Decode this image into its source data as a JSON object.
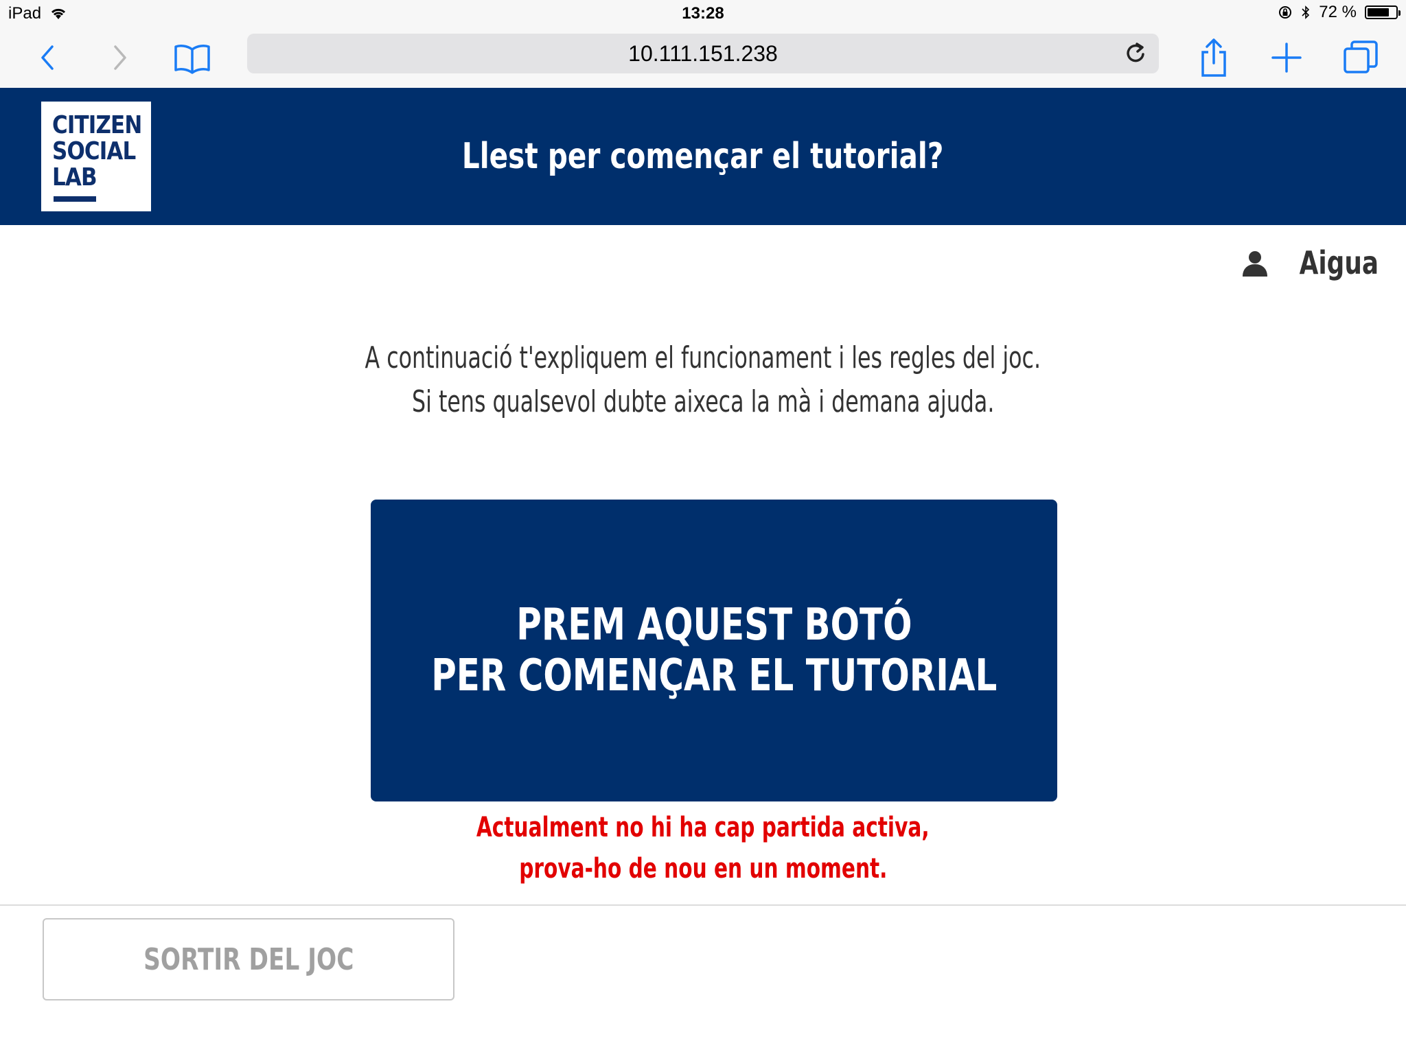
{
  "status_bar": {
    "device": "iPad",
    "time": "13:28",
    "battery_percent": "72 %",
    "battery_level": 0.72
  },
  "browser": {
    "url": "10.111.151.238",
    "icons": [
      "back-icon",
      "forward-icon",
      "bookmarks-icon",
      "reload-icon",
      "share-icon",
      "new-tab-icon",
      "tabs-icon"
    ]
  },
  "header": {
    "logo_lines": [
      "CITIZEN",
      "SOCIAL",
      "LAB"
    ],
    "title": "Llest per començar el tutorial?"
  },
  "user": {
    "name": "Aigua",
    "icon": "user-icon"
  },
  "intro": {
    "line1": "A continuació t'expliquem el funcionament i les regles del joc.",
    "line2": "Si tens qualsevol dubte aixeca la mà i demana ajuda."
  },
  "start_button": {
    "line1": "PREM AQUEST BOTÓ",
    "line2": "PER COMENÇAR EL TUTORIAL"
  },
  "error": {
    "line1": "Actualment no hi ha cap partida activa,",
    "line2": "prova-ho de nou en un moment."
  },
  "footer": {
    "exit_label": "SORTIR DEL JOC"
  },
  "colors": {
    "brand": "#002f6c",
    "error": "#e20000",
    "ios_blue": "#1a7cf5"
  }
}
